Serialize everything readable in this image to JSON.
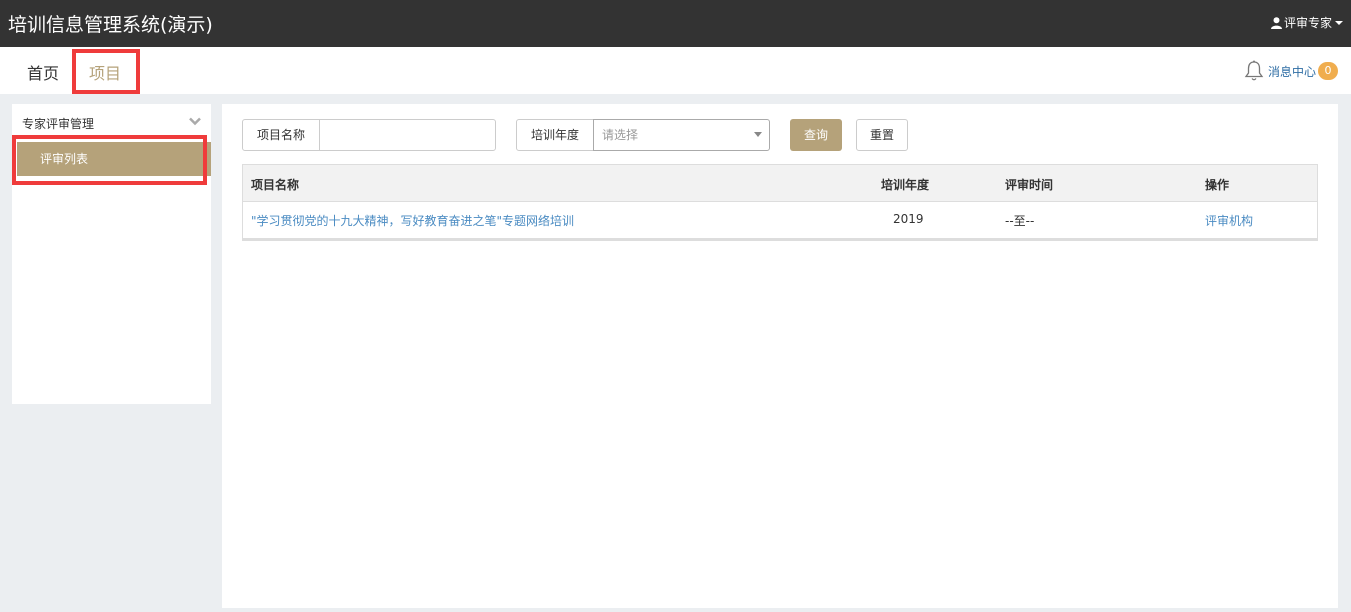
{
  "app": {
    "title": "培训信息管理系统(演示)"
  },
  "user": {
    "name": "评审专家"
  },
  "nav": {
    "items": [
      {
        "label": "首页"
      },
      {
        "label": "项目"
      }
    ],
    "message_center": {
      "label": "消息中心",
      "count": "0"
    }
  },
  "sidebar": {
    "group": "专家评审管理",
    "items": [
      {
        "label": "评审列表"
      }
    ]
  },
  "filters": {
    "project_name_label": "项目名称",
    "project_name_value": "",
    "year_label": "培训年度",
    "year_placeholder": "请选择",
    "query_label": "查询",
    "reset_label": "重置"
  },
  "table": {
    "columns": [
      "项目名称",
      "培训年度",
      "评审时间",
      "操作"
    ],
    "rows": [
      {
        "name": "\"学习贯彻党的十九大精神，写好教育奋进之笔\"专题网络培训",
        "year": "2019",
        "time": "--至--",
        "action": "评审机构"
      }
    ]
  },
  "colors": {
    "topbar": "#333333",
    "accent": "#b5a27a",
    "link": "#4a8bc2",
    "highlight": "#ef3b3b",
    "badge": "#f0ad4e"
  }
}
